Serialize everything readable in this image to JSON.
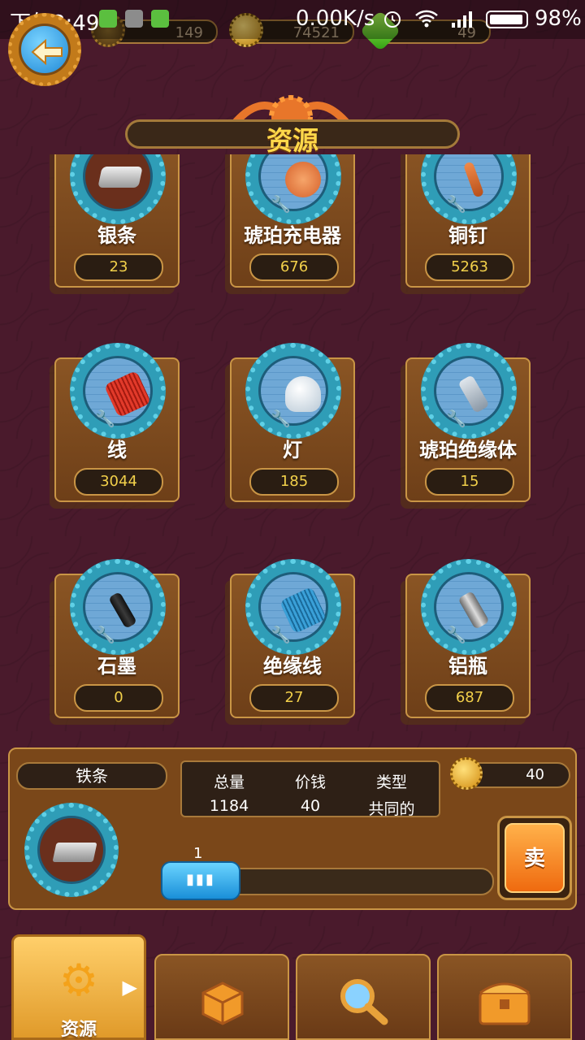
{
  "status_bar": {
    "time": "下午3:49",
    "network": "0.00K/s",
    "battery": "98%"
  },
  "currency": [
    {
      "name": "gear-currency",
      "value": "149"
    },
    {
      "name": "gold-coin",
      "value": "74521"
    },
    {
      "name": "green-gem",
      "value": "49"
    }
  ],
  "title": "资源",
  "resources": [
    {
      "name": "银条",
      "count": "23",
      "icon": "silver-bar-icon"
    },
    {
      "name": "琥珀充电器",
      "count": "676",
      "icon": "amber-charger-icon"
    },
    {
      "name": "铜钉",
      "count": "5263",
      "icon": "copper-nail-icon"
    },
    {
      "name": "线",
      "count": "3044",
      "icon": "thread-spool-icon"
    },
    {
      "name": "灯",
      "count": "185",
      "icon": "lamp-bulb-icon"
    },
    {
      "name": "琥珀绝缘体",
      "count": "15",
      "icon": "amber-insulator-icon"
    },
    {
      "name": "石墨",
      "count": "0",
      "icon": "graphite-icon"
    },
    {
      "name": "绝缘线",
      "count": "27",
      "icon": "insulated-wire-icon"
    },
    {
      "name": "铝瓶",
      "count": "687",
      "icon": "aluminum-bottle-icon"
    }
  ],
  "detail": {
    "name": "铁条",
    "total_label": "总量",
    "total": "1184",
    "price_label": "价钱",
    "price": "40",
    "type_label": "类型",
    "type": "共同的",
    "sell_price": "40",
    "quantity": "1",
    "sell_label": "卖"
  },
  "tabs": [
    {
      "label": "资源",
      "icon": "gear-icon",
      "active": true
    },
    {
      "label": "",
      "icon": "dice-icon"
    },
    {
      "label": "",
      "icon": "magnifier-icon"
    },
    {
      "label": "",
      "icon": "chest-icon"
    }
  ]
}
